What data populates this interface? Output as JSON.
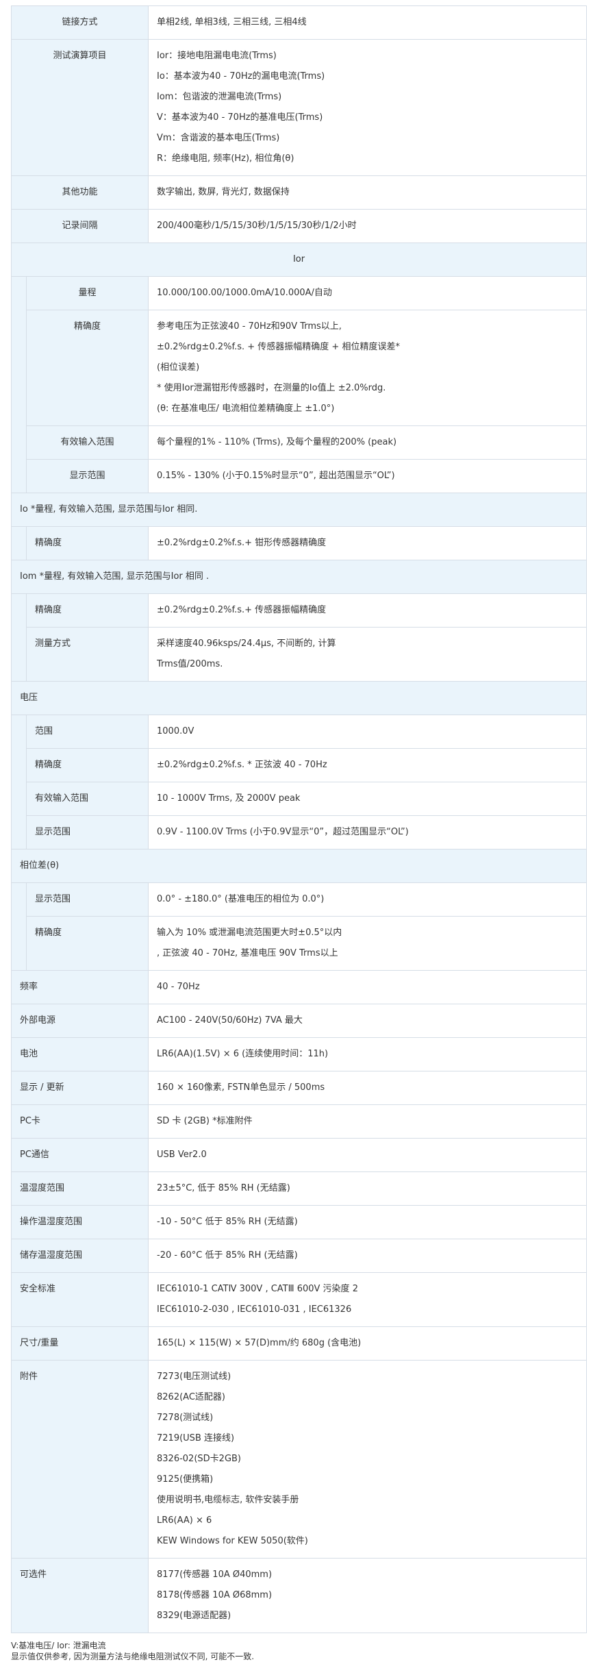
{
  "rows_top": [
    {
      "label": "链接方式",
      "lines": [
        "单相2线, 单相3线, 三相三线, 三相4线"
      ]
    },
    {
      "label": "测试演算项目",
      "lines": [
        "Ior：接地电阻漏电电流(Trms)",
        "Io：基本波为40 - 70Hz的漏电电流(Trms)",
        "Iom：包谐波的泄漏电流(Trms)",
        "V：基本波为40 - 70Hz的基准电压(Trms)",
        "Vm：含谐波的基本电压(Trms)",
        "R：绝缘电阻, 频率(Hz), 相位角(θ)"
      ]
    },
    {
      "label": "其他功能",
      "lines": [
        "数字输出, 数屏, 背光灯, 数据保持"
      ]
    },
    {
      "label": "记录间隔",
      "lines": [
        "200/400毫秒/1/5/15/30秒/1/5/15/30秒/1/2小时"
      ]
    }
  ],
  "ior": {
    "title": "Ior",
    "rows": [
      {
        "label": "量程",
        "lines": [
          "10.000/100.00/1000.0mA/10.000A/自动"
        ]
      },
      {
        "label": "精确度",
        "lines": [
          "参考电压为正弦波40 - 70Hz和90V Trms以上,",
          "±0.2%rdg±0.2%f.s. + 传感器振幅精确度 + 相位精度误差*",
          "(相位误差)",
          "* 使用Ior泄漏钳形传感器时，在测量的Io值上 ±2.0%rdg.",
          "(θ: 在基准电压/ 电流相位差精确度上 ±1.0°)"
        ]
      },
      {
        "label": "有效输入范围",
        "lines": [
          "每个量程的1% - 110% (Trms), 及每个量程的200% (peak)"
        ]
      },
      {
        "label": "显示范围",
        "lines": [
          "0.15% - 130% (小于0.15%时显示“0”, 超出范围显示“OL”)"
        ]
      }
    ]
  },
  "io": {
    "title": "Io *量程, 有效输入范围, 显示范围与Ior 相同.",
    "rows": [
      {
        "label": "精确度",
        "lines": [
          "±0.2%rdg±0.2%f.s.+ 钳形传感器精确度"
        ]
      }
    ]
  },
  "iom": {
    "title": "Iom *量程, 有效输入范围, 显示范围与Ior 相同 .",
    "rows": [
      {
        "label": "精确度",
        "lines": [
          "±0.2%rdg±0.2%f.s.+ 传感器振幅精确度"
        ]
      },
      {
        "label": "测量方式",
        "lines": [
          "采样速度40.96ksps/24.4μs, 不间断的, 计算",
          "Trms值/200ms."
        ]
      }
    ]
  },
  "voltage": {
    "title": "电压",
    "rows": [
      {
        "label": "范围",
        "lines": [
          "1000.0V"
        ]
      },
      {
        "label": "精确度",
        "lines": [
          "±0.2%rdg±0.2%f.s. * 正弦波 40 - 70Hz"
        ]
      },
      {
        "label": "有效输入范围",
        "lines": [
          "10 - 1000V Trms, 及 2000V peak"
        ]
      },
      {
        "label": "显示范围",
        "lines": [
          "0.9V - 1100.0V Trms (小于0.9V显示“0”，超过范围显示“OL”)"
        ]
      }
    ]
  },
  "phase": {
    "title": "相位差(θ)",
    "rows": [
      {
        "label": "显示范围",
        "lines": [
          "0.0° - ±180.0° (基准电压的相位为 0.0°)"
        ]
      },
      {
        "label": "精确度",
        "lines": [
          "输入为 10% 或泄漏电流范围更大时±0.5°以内",
          ", 正弦波 40 - 70Hz, 基准电压 90V Trms以上"
        ]
      }
    ]
  },
  "rows_bottom": [
    {
      "label": "频率",
      "lines": [
        "40 - 70Hz"
      ]
    },
    {
      "label": "外部电源",
      "lines": [
        "AC100 - 240V(50/60Hz) 7VA 最大"
      ]
    },
    {
      "label": "电池",
      "lines": [
        "LR6(AA)(1.5V) × 6 (连续使用时间：11h)"
      ]
    },
    {
      "label": "显示 / 更新",
      "lines": [
        "160 × 160像素, FSTN单色显示 / 500ms"
      ]
    },
    {
      "label": "PC卡",
      "lines": [
        "SD 卡 (2GB) *标准附件"
      ]
    },
    {
      "label": "PC通信",
      "lines": [
        "USB Ver2.0"
      ]
    },
    {
      "label": "温湿度范围",
      "lines": [
        "23±5°C, 低于 85% RH (无结露)"
      ]
    },
    {
      "label": "操作温湿度范围",
      "lines": [
        "-10 - 50°C 低于 85% RH (无结露)"
      ]
    },
    {
      "label": "储存温湿度范围",
      "lines": [
        "-20 - 60°C 低于 85% RH (无结露)"
      ]
    },
    {
      "label": "安全标准",
      "lines": [
        "IEC61010-1 CATⅣ 300V , CATⅢ 600V 污染度 2",
        "IEC61010-2-030 , IEC61010-031 , IEC61326"
      ]
    },
    {
      "label": "尺寸/重量",
      "lines": [
        "165(L) × 115(W) × 57(D)mm/约 680g (含电池)"
      ]
    },
    {
      "label": "附件",
      "lines": [
        "7273(电压测试线)",
        "8262(AC适配器)",
        "7278(测试线)",
        "7219(USB 连接线)",
        "8326-02(SD卡2GB)",
        "9125(便携箱)",
        "使用说明书,电缆标志, 软件安装手册",
        "LR6(AA) × 6",
        "KEW Windows for KEW 5050(软件)"
      ]
    },
    {
      "label": "可选件",
      "lines": [
        "8177(传感器 10A  Ø40mm)",
        "8178(传感器 10A  Ø68mm)",
        "8329(电源适配器)"
      ]
    }
  ],
  "footer": [
    "V:基准电压/ Ior: 泄漏电流",
    "显示值仅供参考, 因为测量方法与绝缘电阻测试仪不同, 可能不一致."
  ]
}
